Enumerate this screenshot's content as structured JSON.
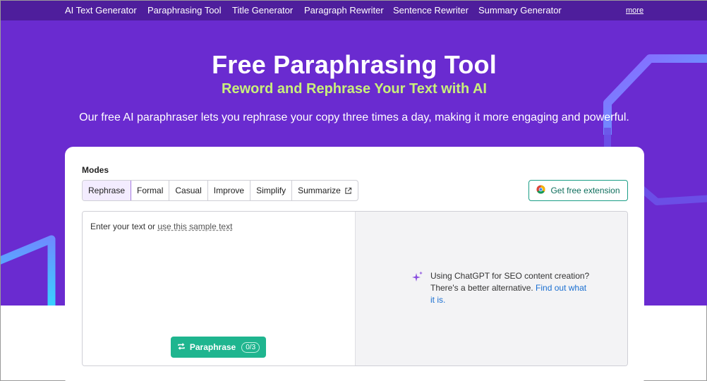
{
  "nav": {
    "items": [
      {
        "label": "AI Text Generator"
      },
      {
        "label": "Paraphrasing Tool"
      },
      {
        "label": "Title Generator"
      },
      {
        "label": "Paragraph Rewriter"
      },
      {
        "label": "Sentence Rewriter"
      },
      {
        "label": "Summary Generator"
      }
    ],
    "more_label": "more"
  },
  "hero": {
    "title": "Free Paraphrasing Tool",
    "subtitle": "Reword and Rephrase Your Text with AI",
    "description": "Our free AI paraphraser lets you rephrase your copy three times a day, making it more engaging and powerful."
  },
  "tool": {
    "modes_label": "Modes",
    "modes": [
      {
        "label": "Rephrase",
        "active": true
      },
      {
        "label": "Formal",
        "active": false
      },
      {
        "label": "Casual",
        "active": false
      },
      {
        "label": "Improve",
        "active": false
      },
      {
        "label": "Simplify",
        "active": false
      },
      {
        "label": "Summarize",
        "active": false,
        "icon": "external-link-icon"
      }
    ],
    "extension_button": {
      "label": "Get free extension",
      "icon": "chrome-icon"
    },
    "input": {
      "placeholder_prefix": "Enter your text or ",
      "sample_link": "use this sample text"
    },
    "paraphrase_button": {
      "label": "Paraphrase",
      "icon": "refresh-icon",
      "counter": "0/3"
    },
    "promo": {
      "icon": "sparkle-icon",
      "text": "Using ChatGPT for SEO content creation? There's a better alternative. ",
      "link": "Find out what it is."
    }
  },
  "colors": {
    "hero_bg": "#6a2bd0",
    "nav_bg": "#4e1e9c",
    "subtitle": "#c9f07a",
    "primary_button": "#1fb58f",
    "link": "#1a6fd1"
  }
}
